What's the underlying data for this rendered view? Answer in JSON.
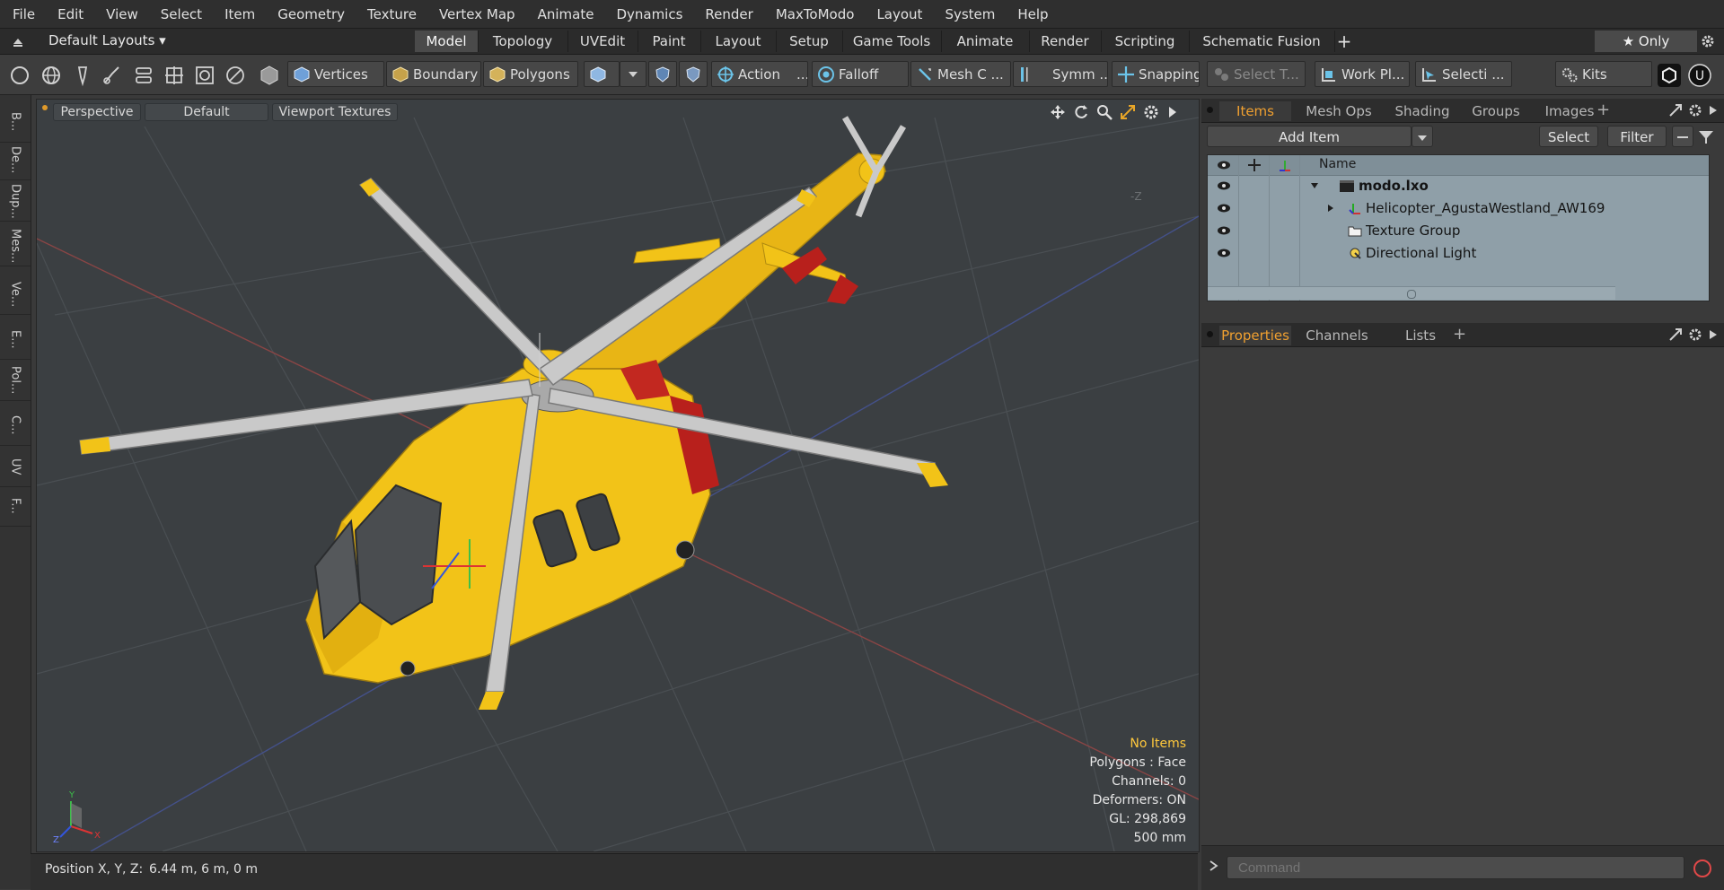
{
  "menu": [
    "File",
    "Edit",
    "View",
    "Select",
    "Item",
    "Geometry",
    "Texture",
    "Vertex Map",
    "Animate",
    "Dynamics",
    "Render",
    "MaxToModo",
    "Layout",
    "System",
    "Help"
  ],
  "layout_selector": "Default Layouts ▾",
  "layout_tabs": [
    "Model",
    "Topology",
    "UVEdit",
    "Paint",
    "Layout",
    "Setup",
    "Game Tools",
    "Animate",
    "Render",
    "Scripting",
    "Schematic Fusion"
  ],
  "active_tab": "Model",
  "only_label": "★  Only",
  "toolbar": {
    "vertices": "Vertices",
    "boundary": "Boundary",
    "polygons": "Polygons",
    "action": "Action",
    "action_more": "...",
    "falloff": "Falloff",
    "mesh": "Mesh C ...",
    "symm": "Symm ...",
    "snapping": "Snapping",
    "select_t": "Select T...",
    "work_plane": "Work Pl...",
    "selection": "Selecti ...",
    "kits": "Kits"
  },
  "left_strip": [
    "B...",
    "De...",
    "Dup...",
    "Mes...",
    "Ve...",
    "E...",
    "Pol...",
    "C...",
    "UV",
    "F..."
  ],
  "viewport": {
    "perspective": "Perspective",
    "default": "Default",
    "textures": "Viewport Textures",
    "axis_z_hint": "-Z",
    "info": {
      "selection": "No Items",
      "polygons": "Polygons : Face",
      "channels": "Channels: 0",
      "deformers": "Deformers: ON",
      "gl": "GL: 298,869",
      "scale": "500 mm"
    }
  },
  "status": {
    "position_label": "Position X, Y, Z:",
    "position_value": "6.44 m, 6 m, 0 m"
  },
  "items_panel": {
    "tabs": [
      "Items",
      "Mesh Ops",
      "Shading",
      "Groups",
      "Images"
    ],
    "active": "Items",
    "add_item": "Add Item",
    "select": "Select",
    "filter": "Filter",
    "name_header": "Name",
    "rows": [
      "modo.lxo",
      "Helicopter_AgustaWestland_AW169",
      "Texture Group",
      "Directional Light"
    ]
  },
  "props_panel": {
    "tabs": [
      "Properties",
      "Channels",
      "Lists"
    ],
    "active": "Properties"
  },
  "command_placeholder": "Command",
  "colors": {
    "accent": "#f0a030",
    "heli_yellow": "#f2c318",
    "heli_red": "#b8201c"
  }
}
